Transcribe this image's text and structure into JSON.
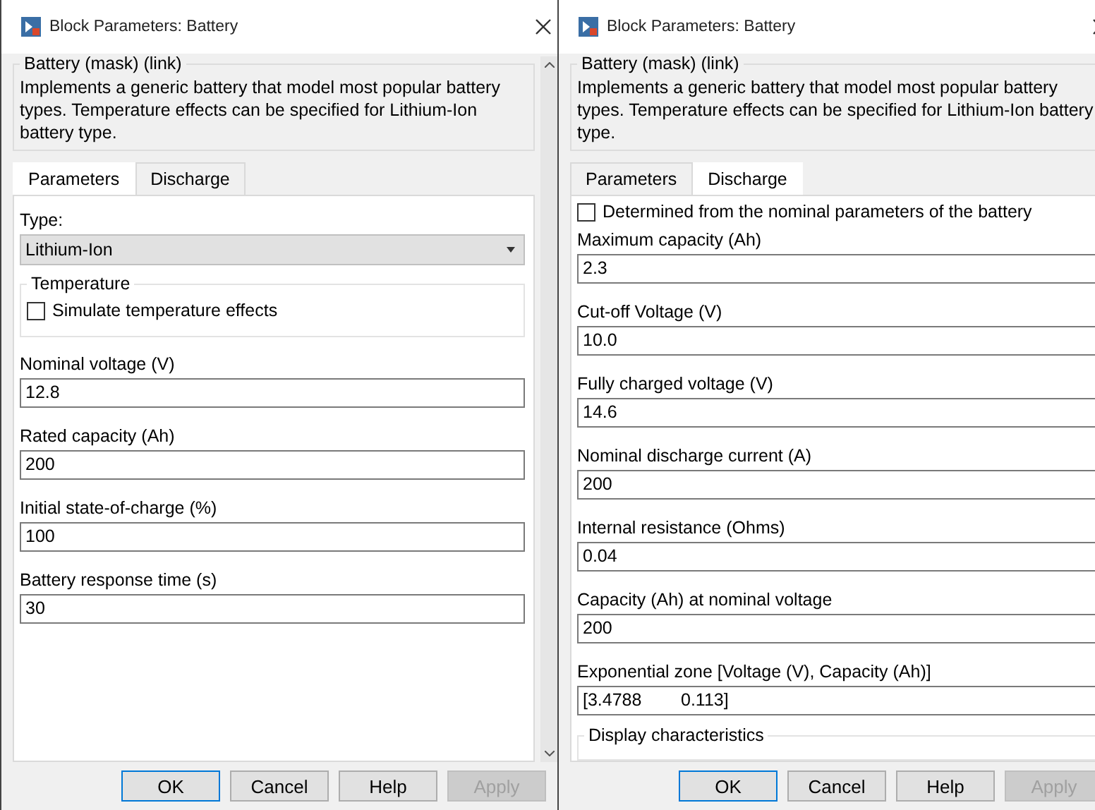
{
  "dialogs": [
    {
      "title": "Block Parameters: Battery",
      "scrollbar": true,
      "header": {
        "legend": "Battery (mask) (link)",
        "description": "Implements a generic battery that model most popular battery types. Temperature effects can be specified for Lithium-Ion battery type."
      },
      "tabs": [
        {
          "label": "Parameters",
          "selected": true
        },
        {
          "label": "Discharge",
          "selected": false
        }
      ],
      "params": [
        {
          "kind": "select",
          "label": "Type:",
          "value": "Lithium-Ion"
        },
        {
          "kind": "group",
          "legend": "Temperature",
          "checkbox": {
            "label": "Simulate temperature effects",
            "checked": false
          }
        },
        {
          "kind": "field",
          "label": "Nominal voltage (V)",
          "value": "12.8"
        },
        {
          "kind": "field",
          "label": "Rated capacity (Ah)",
          "value": "200"
        },
        {
          "kind": "field",
          "label": "Initial state-of-charge (%)",
          "value": "100"
        },
        {
          "kind": "field",
          "label": "Battery response time (s)",
          "value": "30"
        }
      ],
      "buttons": [
        {
          "label": "OK",
          "default": true,
          "disabled": false
        },
        {
          "label": "Cancel",
          "default": false,
          "disabled": false
        },
        {
          "label": "Help",
          "default": false,
          "disabled": false
        },
        {
          "label": "Apply",
          "default": false,
          "disabled": true
        }
      ]
    },
    {
      "title": "Block Parameters: Battery",
      "header": {
        "legend": "Battery (mask) (link)",
        "description": "Implements a generic battery that model most popular battery types. Temperature effects can be specified for Lithium-Ion battery type."
      },
      "tabs": [
        {
          "label": "Parameters",
          "selected": false
        },
        {
          "label": "Discharge",
          "selected": true
        }
      ],
      "params": [
        {
          "kind": "checkbox",
          "label": "Determined from the nominal parameters of the battery",
          "checked": false
        },
        {
          "kind": "field",
          "label": "Maximum capacity (Ah)",
          "value": "2.3"
        },
        {
          "kind": "field",
          "label": "Cut-off Voltage (V)",
          "value": "10.0"
        },
        {
          "kind": "field",
          "label": "Fully charged voltage (V)",
          "value": "14.6"
        },
        {
          "kind": "field",
          "label": "Nominal discharge current (A)",
          "value": "200"
        },
        {
          "kind": "field",
          "label": "Internal resistance (Ohms)",
          "value": "0.04"
        },
        {
          "kind": "field",
          "label": "Capacity (Ah) at nominal voltage",
          "value": "200"
        },
        {
          "kind": "field",
          "label": "Exponential zone [Voltage (V), Capacity (Ah)]",
          "value": "[3.4788        0.113]"
        },
        {
          "kind": "group",
          "legend": "Display characteristics"
        }
      ],
      "buttons": [
        {
          "label": "OK",
          "default": true,
          "disabled": false
        },
        {
          "label": "Cancel",
          "default": false,
          "disabled": false
        },
        {
          "label": "Help",
          "default": false,
          "disabled": false
        },
        {
          "label": "Apply",
          "default": false,
          "disabled": true
        }
      ]
    }
  ]
}
